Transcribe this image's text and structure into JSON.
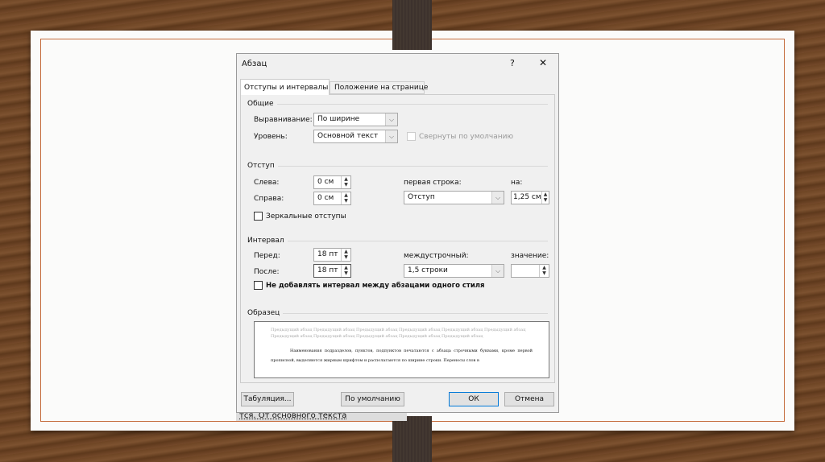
{
  "background_text": "тся. От основного текста",
  "dialog": {
    "title": "Абзац",
    "help": "?",
    "close": "✕",
    "tabs": [
      "Отступы и интервалы",
      "Положение на странице"
    ],
    "general": {
      "heading": "Общие",
      "alignment_label": "Выравнивание:",
      "alignment_value": "По ширине",
      "level_label": "Уровень:",
      "level_value": "Основной текст",
      "collapsed_label": "Свернуты по умолчанию"
    },
    "indent": {
      "heading": "Отступ",
      "left_label": "Слева:",
      "left_value": "0 см",
      "right_label": "Справа:",
      "right_value": "0 см",
      "first_line_label": "первая строка:",
      "first_line_value": "Отступ",
      "by_label": "на:",
      "by_value": "1,25 см",
      "mirror_label": "Зеркальные отступы"
    },
    "spacing": {
      "heading": "Интервал",
      "before_label": "Перед:",
      "before_value": "18 пт",
      "after_label": "После:",
      "after_value": "18 пт",
      "line_label": "междустрочный:",
      "line_value": "1,5 строки",
      "at_label": "значение:",
      "at_value": "",
      "no_space_label": "Не добавлять интервал между абзацами одного стиля"
    },
    "preview": {
      "heading": "Образец",
      "prev_text": "Предыдущий абзац Предыдущий абзац Предыдущий абзац Предыдущий абзац Предыдущий абзац Предыдущий абзац Предыдущий абзац Предыдущий абзац Предыдущий абзац Предыдущий абзац Предыдущий абзац",
      "sample_text": "Наименования подразделов, пунктов, подпунктов печатаются с абзаца строчными буквами, кроме первой прописной, выделяются жирным шрифтом и располагаются по ширине строки. Переносы слов в"
    },
    "buttons": {
      "tabs": "Табуляция...",
      "default": "По умолчанию",
      "ok": "ОК",
      "cancel": "Отмена"
    }
  }
}
